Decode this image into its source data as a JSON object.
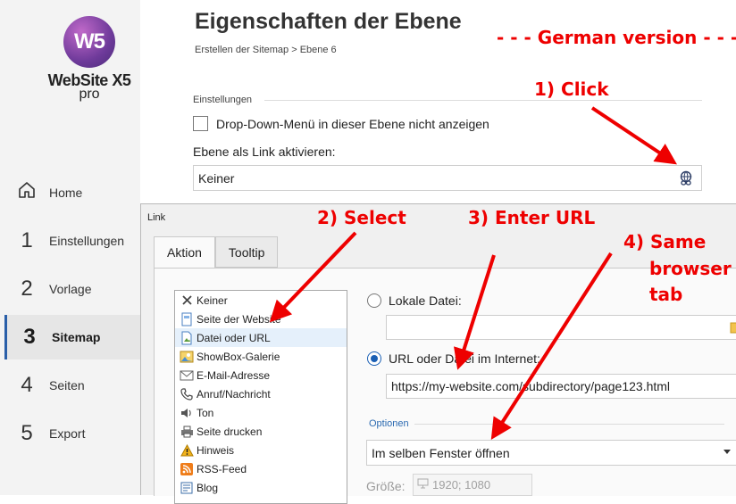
{
  "app": {
    "logo_mark": "W5",
    "logo_name": "WebSite X5",
    "logo_edition": "pro"
  },
  "sidebar": {
    "items": [
      {
        "num": "",
        "label": "Home",
        "icon": "home-icon"
      },
      {
        "num": "1",
        "label": "Einstellungen"
      },
      {
        "num": "2",
        "label": "Vorlage"
      },
      {
        "num": "3",
        "label": "Sitemap",
        "active": true
      },
      {
        "num": "4",
        "label": "Seiten"
      },
      {
        "num": "5",
        "label": "Export"
      }
    ]
  },
  "page": {
    "title": "Eigenschaften der Ebene",
    "breadcrumb": "Erstellen der Sitemap > Ebene 6",
    "section": "Einstellungen",
    "checkbox_label": "Drop-Down-Menü in dieser Ebene nicht anzeigen",
    "link_label": "Ebene als Link aktivieren:",
    "link_value": "Keiner"
  },
  "dialog": {
    "title": "Link",
    "tabs": [
      "Aktion",
      "Tooltip"
    ],
    "actions": [
      {
        "label": "Keiner",
        "icon": "x-icon"
      },
      {
        "label": "Seite der Website",
        "icon": "page-icon"
      },
      {
        "label": "Datei oder URL",
        "icon": "file-icon",
        "selected": true
      },
      {
        "label": "ShowBox-Galerie",
        "icon": "gallery-icon"
      },
      {
        "label": "E-Mail-Adresse",
        "icon": "email-icon"
      },
      {
        "label": "Anruf/Nachricht",
        "icon": "phone-icon"
      },
      {
        "label": "Ton",
        "icon": "speaker-icon"
      },
      {
        "label": "Seite drucken",
        "icon": "printer-icon"
      },
      {
        "label": "Hinweis",
        "icon": "warning-icon"
      },
      {
        "label": "RSS-Feed",
        "icon": "rss-icon"
      },
      {
        "label": "Blog",
        "icon": "blog-icon"
      }
    ],
    "local_file_label": "Lokale Datei:",
    "local_file_value": "",
    "url_label": "URL oder Datei im Internet:",
    "url_value": "https://my-website.com/subdirectory/page123.html",
    "options_label": "Optionen",
    "window_option": "Im selben Fenster öffnen",
    "size_label": "Größe:",
    "size_value": "1920; 1080"
  },
  "annotations": {
    "version": "- - - German version - - -",
    "step1": "1) Click",
    "step2": "2) Select",
    "step3": "3) Enter URL",
    "step4_line1": "4) Same",
    "step4_line2": "browser",
    "step4_line3": "tab",
    "color": "#ee0000"
  }
}
